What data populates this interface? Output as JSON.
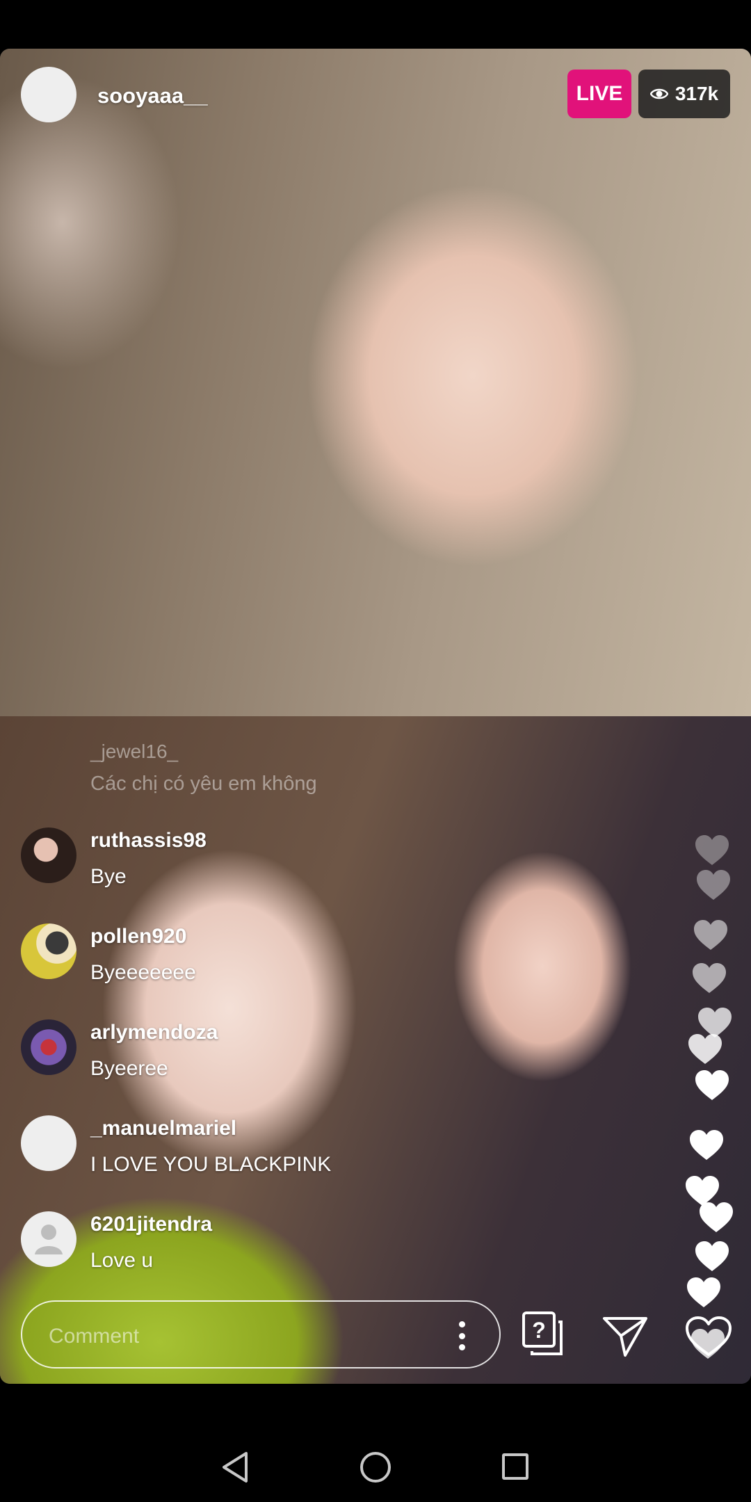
{
  "header": {
    "host_username": "sooyaaa__",
    "live_label": "LIVE",
    "viewer_count": "317k"
  },
  "faded_comment": {
    "username": "_jewel16_",
    "text": "Các chị có yêu em không"
  },
  "comments": [
    {
      "username": "ruthassis98",
      "text": "Bye"
    },
    {
      "username": "pollen920",
      "text": "Byeeeeeee"
    },
    {
      "username": "arlymendoza",
      "text": "Byeeree"
    },
    {
      "username": "_manuelmariel",
      "text": "I LOVE YOU BLACKPINK"
    },
    {
      "username": "6201jitendra",
      "text": "Love u"
    }
  ],
  "footer": {
    "comment_placeholder": "Comment"
  },
  "colors": {
    "live_badge": "#e1127a",
    "viewer_pill": "#1e1e1e"
  },
  "icons": [
    "eye-icon",
    "more-icon",
    "question-icon",
    "send-icon",
    "heart-icon",
    "back-icon",
    "home-icon",
    "recents-icon"
  ]
}
